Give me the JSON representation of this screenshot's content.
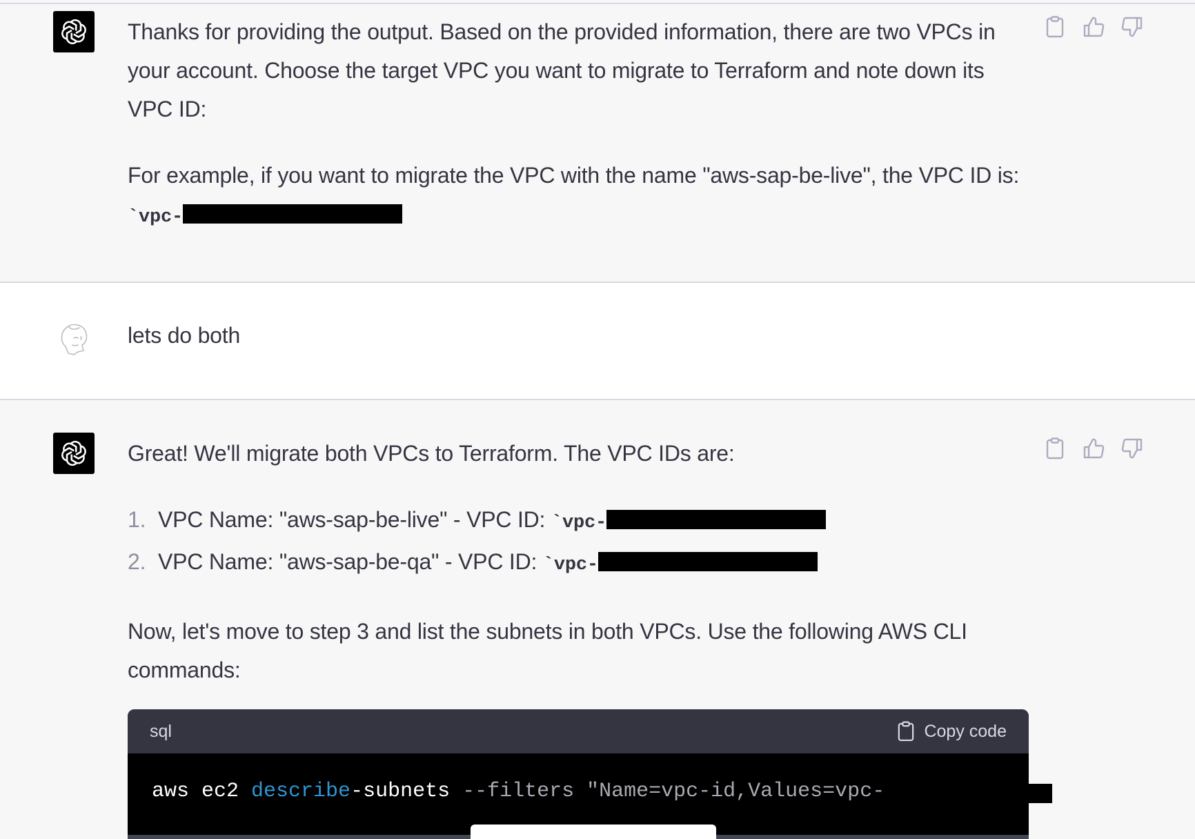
{
  "messages": {
    "first_assistant": {
      "para1": "Thanks for providing the output. Based on the provided information, there are two VPCs in your account. Choose the target VPC you want to migrate to Terraform and note down its VPC ID:",
      "para2": "For example, if you want to migrate the VPC with the name \"aws-sap-be-live\", the VPC ID is:",
      "vpc_prefix": "`vpc-"
    },
    "user": {
      "text": "lets do both"
    },
    "second_assistant": {
      "intro": "Great! We'll migrate both VPCs to Terraform. The VPC IDs are:",
      "vpc_list": [
        {
          "num": "1.",
          "text": "VPC Name: \"aws-sap-be-live\" - VPC ID: ",
          "code": "`vpc-"
        },
        {
          "num": "2.",
          "text": "VPC Name: \"aws-sap-be-qa\" - VPC ID: ",
          "code": "`vpc-"
        }
      ],
      "para_next": "Now, let's move to step 3 and list the subnets in both VPCs. Use the following AWS CLI commands:",
      "code_block": {
        "language": "sql",
        "copy_label": "Copy code",
        "tokens": [
          {
            "text": "aws ec2 ",
            "style": "plain"
          },
          {
            "text": "describe",
            "style": "kw"
          },
          {
            "text": "-subnets ",
            "style": "plain"
          },
          {
            "text": "--filters \"Name=vpc-id,Values=vpc-",
            "style": "dim"
          }
        ]
      }
    }
  },
  "colors": {
    "assistant_bg": "#f7f7f8",
    "user_bg": "#ffffff",
    "code_header_bg": "#343541",
    "code_bg": "#000000",
    "keyword": "#2e95d3"
  },
  "icons": {
    "bot_avatar": "openai-logo-icon",
    "user_avatar": "user-avatar-icon",
    "copy": "clipboard-icon",
    "like": "thumbs-up-icon",
    "dislike": "thumbs-down-icon"
  }
}
